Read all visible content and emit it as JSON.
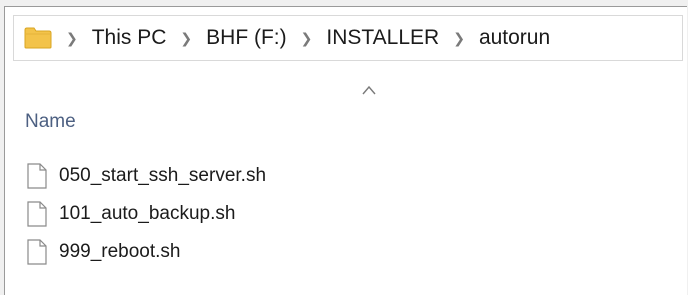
{
  "address_bar": {
    "icon": "folder-icon",
    "breadcrumbs": [
      "This PC",
      "BHF (F:)",
      "INSTALLER",
      "autorun"
    ]
  },
  "column_header": {
    "label": "Name",
    "sort_indicator": "sort-ascending-icon"
  },
  "files": [
    {
      "name": "050_start_ssh_server.sh",
      "icon": "file-icon"
    },
    {
      "name": "101_auto_backup.sh",
      "icon": "file-icon"
    },
    {
      "name": "999_reboot.sh",
      "icon": "file-icon"
    }
  ],
  "colors": {
    "folder_yellow": "#f3c34a",
    "header_text": "#4d6082",
    "chevron": "#7a7a7a"
  }
}
